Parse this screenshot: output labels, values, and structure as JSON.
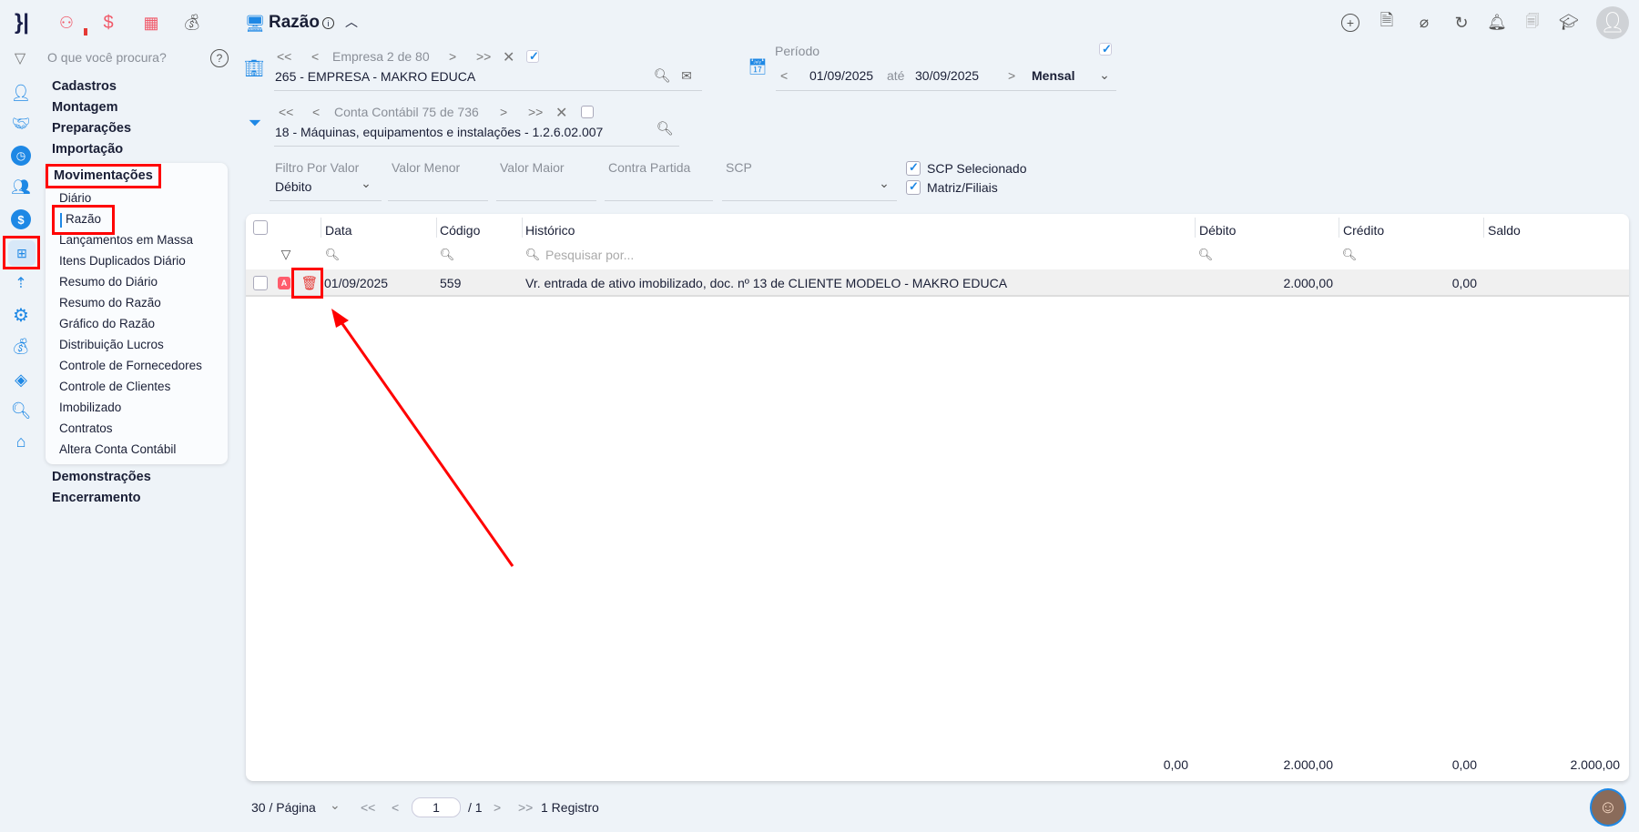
{
  "header": {
    "title": "Razão",
    "top_icons": [
      "plus-circle-icon",
      "document-icon",
      "broom-icon",
      "refresh-icon",
      "bell-icon",
      "report-search-icon",
      "graduation-cap-icon",
      "user-avatar"
    ]
  },
  "sidebar": {
    "search_placeholder": "O que você procura?",
    "menu": [
      "Cadastros",
      "Montagem",
      "Preparações",
      "Importação"
    ],
    "active_group": "Movimentações",
    "submenu": [
      "Diário",
      "Razão",
      "Lançamentos em Massa",
      "Itens Duplicados Diário",
      "Resumo do Diário",
      "Resumo do Razão",
      "Gráfico do Razão",
      "Distribuição Lucros",
      "Controle de Fornecedores",
      "Controle de Clientes",
      "Imobilizado",
      "Contratos",
      "Altera Conta Contábil"
    ],
    "menu_after": [
      "Demonstrações",
      "Encerramento"
    ]
  },
  "empresa": {
    "nav_label": "Empresa 2 de 80",
    "value": "265 - EMPRESA - MAKRO EDUCA"
  },
  "conta": {
    "nav_label": "Conta Contábil 75 de 736",
    "value": "18 - Máquinas, equipamentos e instalações - 1.2.6.02.007"
  },
  "periodo": {
    "label": "Período",
    "start": "01/09/2025",
    "sep": "até",
    "end": "30/09/2025",
    "type": "Mensal"
  },
  "filters": {
    "filtro_label": "Filtro Por Valor",
    "filtro_value": "Débito",
    "valor_menor": "Valor Menor",
    "valor_maior": "Valor Maior",
    "contra_partida": "Contra Partida",
    "scp": "SCP",
    "scp_selecionado": "SCP Selecionado",
    "matriz_filiais": "Matriz/Filiais"
  },
  "table": {
    "columns": [
      "Data",
      "Código",
      "Histórico",
      "Débito",
      "Crédito",
      "Saldo"
    ],
    "search_placeholder": "Pesquisar por...",
    "rows": [
      {
        "badge": "A",
        "data": "01/09/2025",
        "codigo": "559",
        "historico": "Vr. entrada de ativo imobilizado, doc. nº 13 de CLIENTE MODELO - MAKRO EDUCA",
        "debito": "2.000,00",
        "credito": "0,00"
      }
    ],
    "totals": [
      "0,00",
      "2.000,00",
      "0,00",
      "2.000,00"
    ]
  },
  "pagination": {
    "per_page": "30 / Página",
    "page": "1",
    "total_pages": "/ 1",
    "records": "1 Registro"
  },
  "colors": {
    "accent": "#1e88e5",
    "highlight": "#ff0000",
    "badge": "#ff5c6c"
  }
}
